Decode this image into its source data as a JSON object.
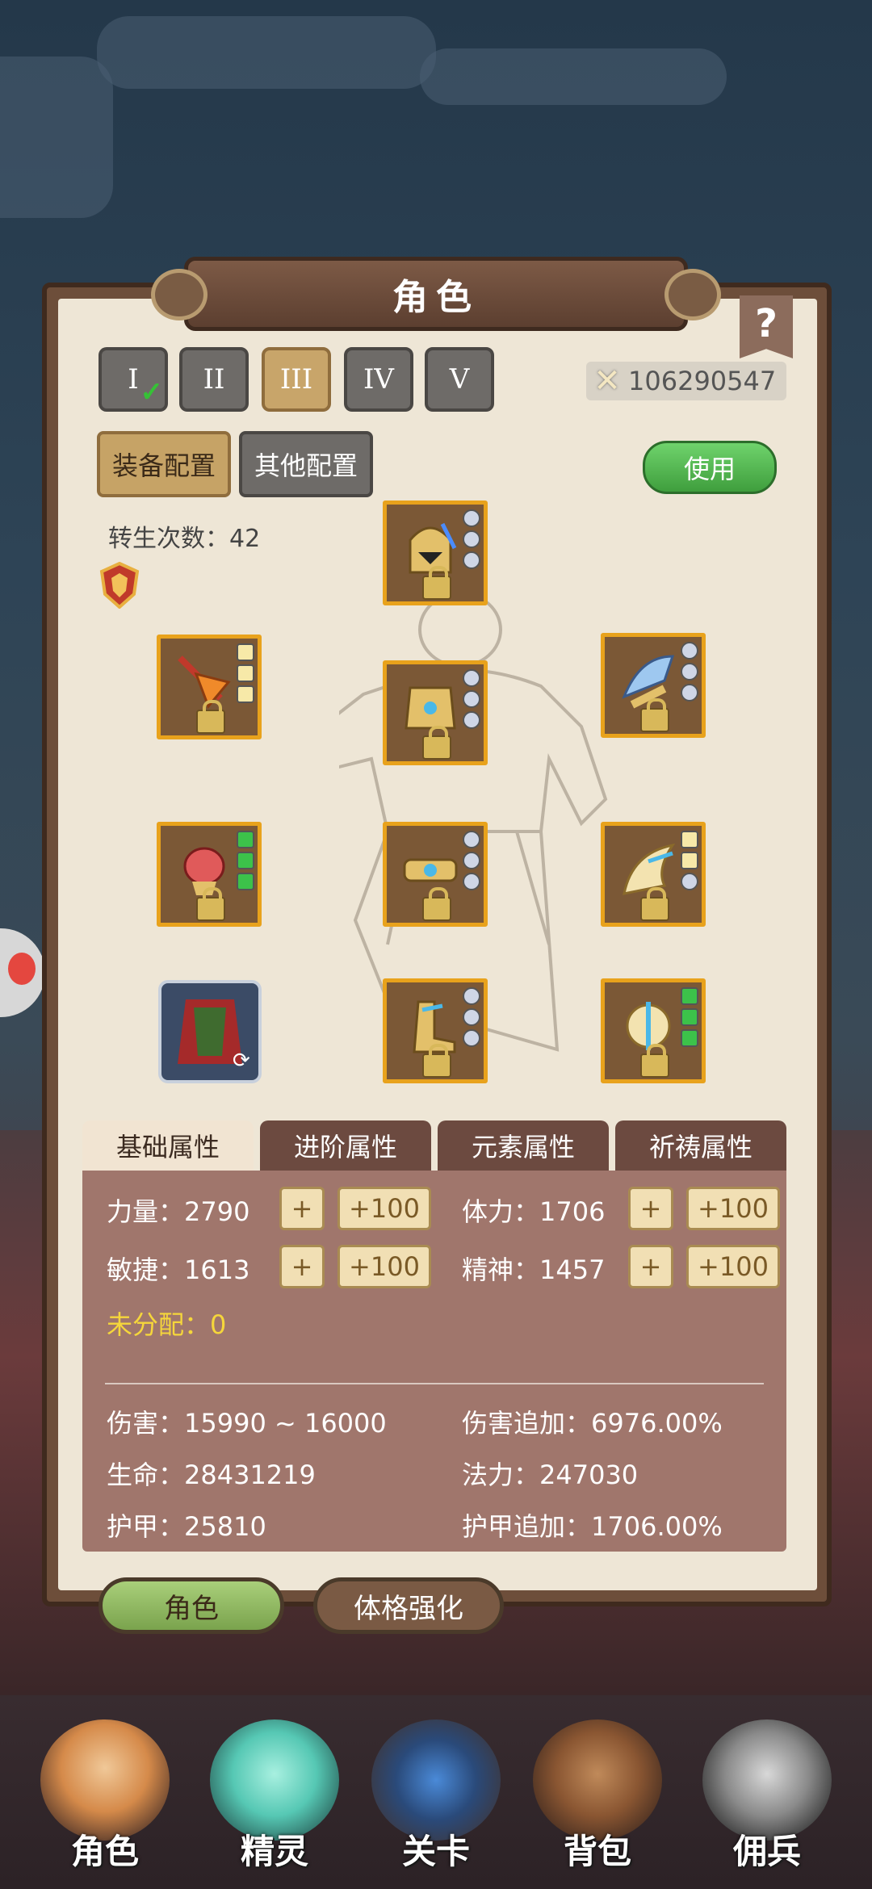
{
  "title": "角色",
  "help_label": "?",
  "tiers": [
    "I",
    "II",
    "III",
    "IV",
    "V"
  ],
  "power": "106290547",
  "config_tabs": {
    "equip": "装备配置",
    "other": "其他配置"
  },
  "use_button": "使用",
  "rebirth": "转生次数：42",
  "attr_tabs": [
    "基础属性",
    "进阶属性",
    "元素属性",
    "祈祷属性"
  ],
  "attributes": {
    "strength": "力量：2790",
    "stamina": "体力：1706",
    "agility": "敏捷：1613",
    "spirit": "精神：1457",
    "plus": "+",
    "plus100": "+100",
    "unassigned": "未分配：0"
  },
  "derived": {
    "damage": "伤害：15990 ~ 16000",
    "damage_bonus": "伤害追加：6976.00%",
    "life": "生命：28431219",
    "mana": "法力：247030",
    "armor": "护甲：25810",
    "armor_bonus": "护甲追加：1706.00%"
  },
  "bottom_tabs": {
    "role": "角色",
    "physique": "体格强化"
  },
  "nav": [
    "角色",
    "精灵",
    "关卡",
    "背包",
    "佣兵"
  ],
  "colors": {
    "slot_border": "#e8a21c",
    "use_green": "#4fb84c",
    "unassigned": "#f5d63b"
  },
  "icons": [
    "helmet-icon",
    "sword-icon",
    "chest-armor-icon",
    "shoulder-icon",
    "gem-glove-icon",
    "belt-icon",
    "wing-icon",
    "cape-icon",
    "boots-icon",
    "amulet-icon",
    "lock-icon",
    "crossed-swords-icon"
  ]
}
